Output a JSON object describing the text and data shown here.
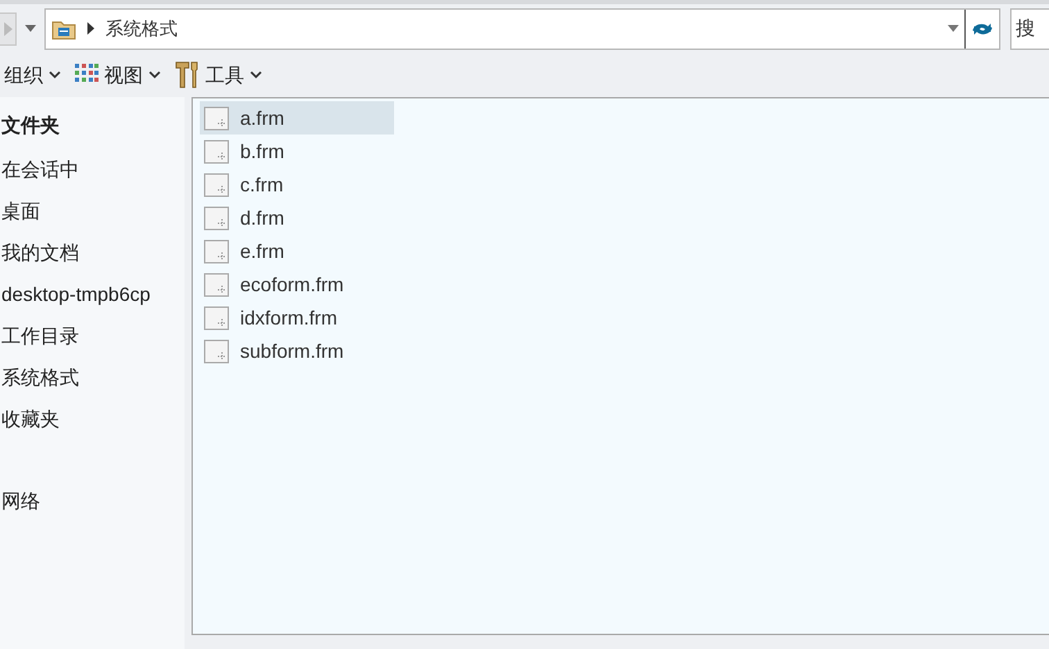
{
  "address_bar": {
    "path": "系统格式"
  },
  "search": {
    "placeholder": "搜"
  },
  "toolbar": [
    {
      "label": "组织",
      "kind": "plain"
    },
    {
      "label": "视图",
      "kind": "grid"
    },
    {
      "label": "工具",
      "kind": "tools"
    }
  ],
  "sidebar": {
    "items": [
      {
        "label": "文件夹",
        "kind": "header"
      },
      {
        "label": "在会话中",
        "kind": "item"
      },
      {
        "label": "桌面",
        "kind": "item"
      },
      {
        "label": "我的文档",
        "kind": "item"
      },
      {
        "label": "desktop-tmpb6cp",
        "kind": "item"
      },
      {
        "label": "工作目录",
        "kind": "item"
      },
      {
        "label": "系统格式",
        "kind": "item"
      },
      {
        "label": "收藏夹",
        "kind": "item"
      },
      {
        "label": "网络",
        "kind": "spaced"
      }
    ]
  },
  "files": [
    {
      "name": "a.frm",
      "selected": true
    },
    {
      "name": "b.frm",
      "selected": false
    },
    {
      "name": "c.frm",
      "selected": false
    },
    {
      "name": "d.frm",
      "selected": false
    },
    {
      "name": "e.frm",
      "selected": false
    },
    {
      "name": "ecoform.frm",
      "selected": false
    },
    {
      "name": "idxform.frm",
      "selected": false
    },
    {
      "name": "subform.frm",
      "selected": false
    }
  ]
}
